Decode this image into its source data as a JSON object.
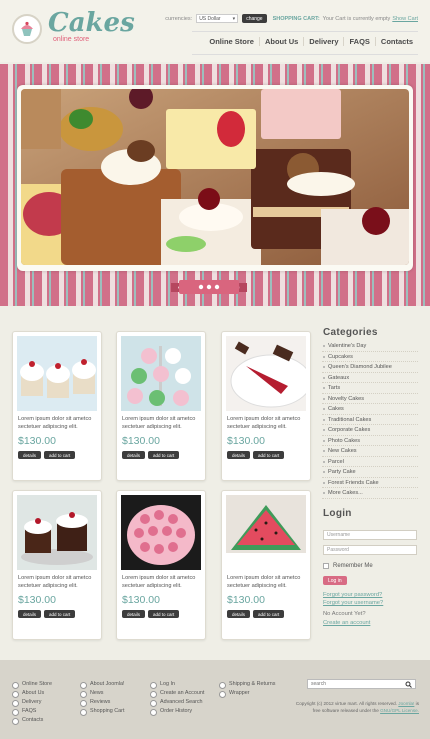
{
  "brand": {
    "title": "Cakes",
    "subtitle": "online store"
  },
  "topbar": {
    "currency_label": "currencies:",
    "currency_value": "US Dollar",
    "change_label": "change",
    "cart_label": "SHOPPING CART:",
    "cart_text": "Your Cart is currently empty",
    "cart_show": "Show Cart"
  },
  "nav": [
    "Online Store",
    "About Us",
    "Delivery",
    "FAQS",
    "Contacts"
  ],
  "products": [
    {
      "desc": "Lorem ipsum dolor sit ametco sectetuer adipiscing elit.",
      "price": "$130.00",
      "details": "details",
      "add": "add to cart"
    },
    {
      "desc": "Lorem ipsum dolor sit ametco sectetuer adipiscing elit.",
      "price": "$130.00",
      "details": "details",
      "add": "add to cart"
    },
    {
      "desc": "Lorem ipsum dolor sit ametco sectetuer adipiscing elit.",
      "price": "$130.00",
      "details": "details",
      "add": "add to cart"
    },
    {
      "desc": "Lorem ipsum dolor sit ametco sectetuer adipiscing elit.",
      "price": "$130.00",
      "details": "details",
      "add": "add to cart"
    },
    {
      "desc": "Lorem ipsum dolor sit ametco sectetuer adipiscing elit.",
      "price": "$130.00",
      "details": "details",
      "add": "add to cart"
    },
    {
      "desc": "Lorem ipsum dolor sit ametco sectetuer adipiscing elit.",
      "price": "$130.00",
      "details": "details",
      "add": "add to cart"
    }
  ],
  "categories": {
    "title": "Categories",
    "items": [
      "Valentine's Day",
      "Cupcakes",
      "Queen's Diamond Jubilee",
      "Gateaux",
      "Tarts",
      "Novelty Cakes",
      "Cakes",
      "Traditional Cakes",
      "Corporate Cakes",
      "Photo Cakes",
      "New Cakes",
      "Parcel",
      "Party Cake",
      "Forest Friends Cake",
      "More Cakes..."
    ]
  },
  "login": {
    "title": "Login",
    "username_placeholder": "Username",
    "password_placeholder": "Password",
    "remember": "Remember Me",
    "button": "Log in",
    "forgot_password": "Forgot your password?",
    "forgot_username": "Forgot your username?",
    "no_account": "No Account Yet?",
    "create": "Create an account"
  },
  "footer": {
    "col1": [
      "Online Store",
      "About Us",
      "Delivery",
      "FAQS",
      "Contacts"
    ],
    "col2": [
      "About Joomla!",
      "News",
      "Reviews",
      "Shopping Cart"
    ],
    "col3": [
      "Log In",
      "Create an Account",
      "Advanced Search",
      "Order History"
    ],
    "col4": [
      "Shipping & Returns",
      "Wrapper"
    ],
    "search_placeholder": "search",
    "copyright_1": "Copyright (c) 2012 virtue mart. All rights reserved.",
    "license_link": "Joomla!",
    "copyright_2": "is free software released under the",
    "gnu_link": "GNU/GPL License."
  }
}
